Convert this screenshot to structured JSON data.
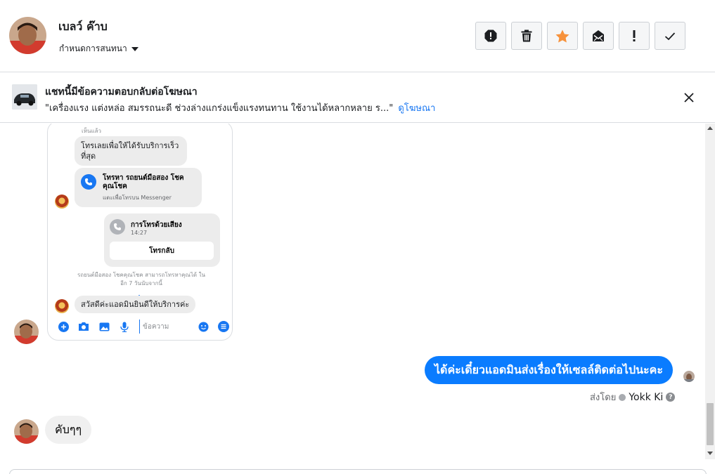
{
  "header": {
    "contact_name": "เบลว์ ค๊าบ",
    "settings_label": "กำหนดการสนทนา",
    "actions": [
      "report-icon",
      "trash-icon",
      "star-icon",
      "mark-unread-icon",
      "spam-icon",
      "done-icon"
    ],
    "star_color": "#f7923b"
  },
  "ad": {
    "title": "แชทนี้มีข้อความตอบกลับต่อโฆษณา",
    "description": "\"เครื่องแรง แต่งหล่อ สมรรถนะดี ช่วงล่างแกร่งแข็งแรงทนทาน ใช้งานได้หลากหลาย ร...\"",
    "link_label": "ดูโฆษณา"
  },
  "screenshot": {
    "top_note": "เห็นแล้ว",
    "bubble1": "โทรเลยเพื่อให้ได้รับบริการเร็ว ที่สุด",
    "call_card_title": "โทรหา รถยนต์มือสอง โชค คุณโชค",
    "call_card_sub": "แตะเพื่อโทรบน Messenger",
    "voice_call_title": "การโทรด้วยเสียง",
    "voice_call_time": "14:27",
    "call_back_label": "โทรกลับ",
    "system_note": "รถยนต์มือสอง โชคคุณโชค สามารถโทรหาคุณได้ ในอีก 7 วันนับจากนี้",
    "last_bubble": "สวัสดีค่ะแอดมินยินดีให้บริการค่ะ",
    "input_placeholder": "ข้อความ"
  },
  "messages": {
    "outgoing_text": "ได้ค่ะเดี๋ยวแอดมินส่งเรื่องให้เซลล์ติดต่อไปนะคะ",
    "sent_by_label": "ส่งโดย",
    "sent_by_name": "Yokk Ki",
    "incoming_text": "คับๆๆ",
    "outgoing_color": "#0a7cff"
  }
}
